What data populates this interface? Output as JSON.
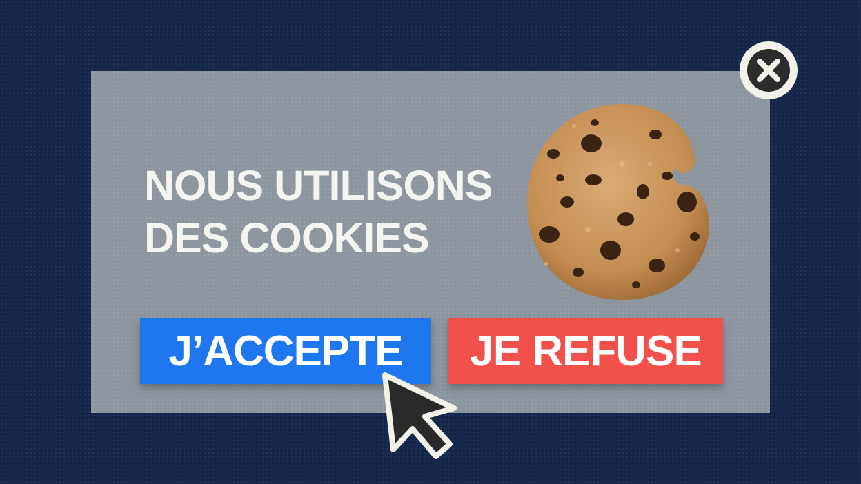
{
  "dialog": {
    "headline_line1": "NOUS UTILISONS",
    "headline_line2": "DES COOKIES",
    "accept_label": "J’ACCEPTE",
    "refuse_label": "JE REFUSE",
    "close_icon": "close-icon",
    "image_icon": "cookie-image"
  },
  "colors": {
    "background": "#14274a",
    "dialog": "#8d959e",
    "accept": "#1f77f0",
    "refuse": "#f2504a",
    "text": "#f4f5f0"
  }
}
